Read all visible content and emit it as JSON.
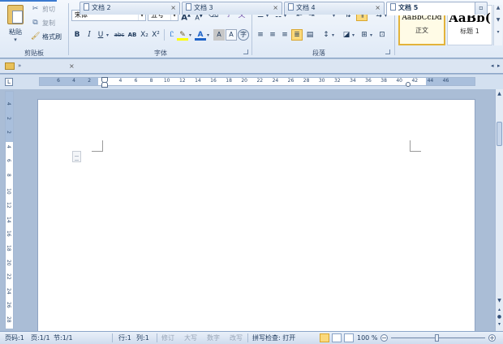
{
  "ribbon": {
    "clipboard": {
      "paste_label": "粘贴",
      "cut_label": "剪切",
      "copy_label": "复制",
      "format_painter_label": "格式刷",
      "group_label": "剪贴板"
    },
    "font": {
      "font_name": "宋体",
      "font_size": "五号",
      "group_label": "字体",
      "bold": "B",
      "italic": "I",
      "underline": "U",
      "strike": "abc",
      "double_strike": "AB",
      "subscript": "X₂",
      "superscript": "X²",
      "grow": "A",
      "shrink": "A",
      "font_color": "A",
      "char_border": "A",
      "phonetic": "文",
      "icon_names": [
        "clear-format-icon",
        "phonetic-guide-icon",
        "text-effects-icon",
        "highlight-icon",
        "char-shading-icon",
        "enclose-char-icon"
      ]
    },
    "paragraph": {
      "group_label": "段落",
      "icon_names": [
        "bullets-icon",
        "numbering-icon",
        "decrease-indent-icon",
        "increase-indent-icon",
        "chinese-layout-icon",
        "sort-icon",
        "show-marks-icon",
        "align-left-icon",
        "align-center-icon",
        "align-right-icon",
        "justify-icon",
        "distributed-icon",
        "line-spacing-icon",
        "shading-icon",
        "borders-icon",
        "tab-icon"
      ]
    },
    "styles": {
      "items": [
        {
          "sample": "AaBbCcDd",
          "name": "正文",
          "selected": true
        },
        {
          "sample": "AaBb(",
          "name": "标题 1",
          "selected": false
        }
      ]
    }
  },
  "tabs": [
    {
      "label": "文档 2",
      "active": false
    },
    {
      "label": "文档 3",
      "active": false
    },
    {
      "label": "文档 4",
      "active": false
    },
    {
      "label": "文档 5",
      "active": true
    }
  ],
  "tabbar_overflow": "»",
  "ruler": {
    "tab_selector": "L",
    "h_ticks": [
      "6",
      "4",
      "2",
      "2",
      "4",
      "6",
      "8",
      "10",
      "12",
      "14",
      "16",
      "18",
      "20",
      "22",
      "24",
      "26",
      "28",
      "30",
      "32",
      "34",
      "36",
      "38",
      "40",
      "42",
      "44",
      "46"
    ],
    "v_ticks": [
      "4",
      "2",
      "2",
      "4",
      "6",
      "8",
      "10",
      "12",
      "14",
      "16",
      "18",
      "20",
      "22",
      "24",
      "26",
      "28"
    ]
  },
  "status": {
    "page": "页码:1",
    "pages": "页:1/1",
    "section": "节:1/1",
    "row": "行:1",
    "column": "列:1",
    "revise": "修订",
    "caps": "大写",
    "num": "数字",
    "overwrite": "改写",
    "spell_check": "拼写检查: 打开",
    "zoom": "100 %"
  },
  "colors": {
    "accent": "#fbd97b",
    "ribbon_bg": "#dfe9f6",
    "workspace_bg": "#aabdd6"
  }
}
